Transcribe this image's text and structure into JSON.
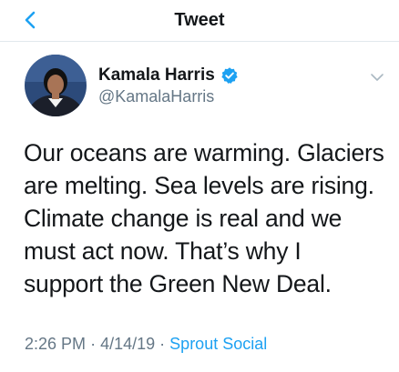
{
  "header": {
    "title": "Tweet",
    "back_icon": "chevron-left-icon"
  },
  "colors": {
    "accent": "#1da1f2",
    "text": "#14171a",
    "secondary": "#657786",
    "divider": "#e1e8ed"
  },
  "author": {
    "name": "Kamala Harris",
    "handle": "@KamalaHarris",
    "verified": true,
    "verified_icon": "verified-badge-icon"
  },
  "tweet": {
    "text": "Our oceans are warming. Glaciers\nare melting. Sea levels are rising.\nClimate change is real and we\nmust act now. That’s why I\nsupport the Green New Deal.",
    "time": "2:26 PM",
    "date": "4/14/19",
    "separator": "·",
    "source": "Sprout Social"
  },
  "menu_icon": "chevron-down-icon"
}
